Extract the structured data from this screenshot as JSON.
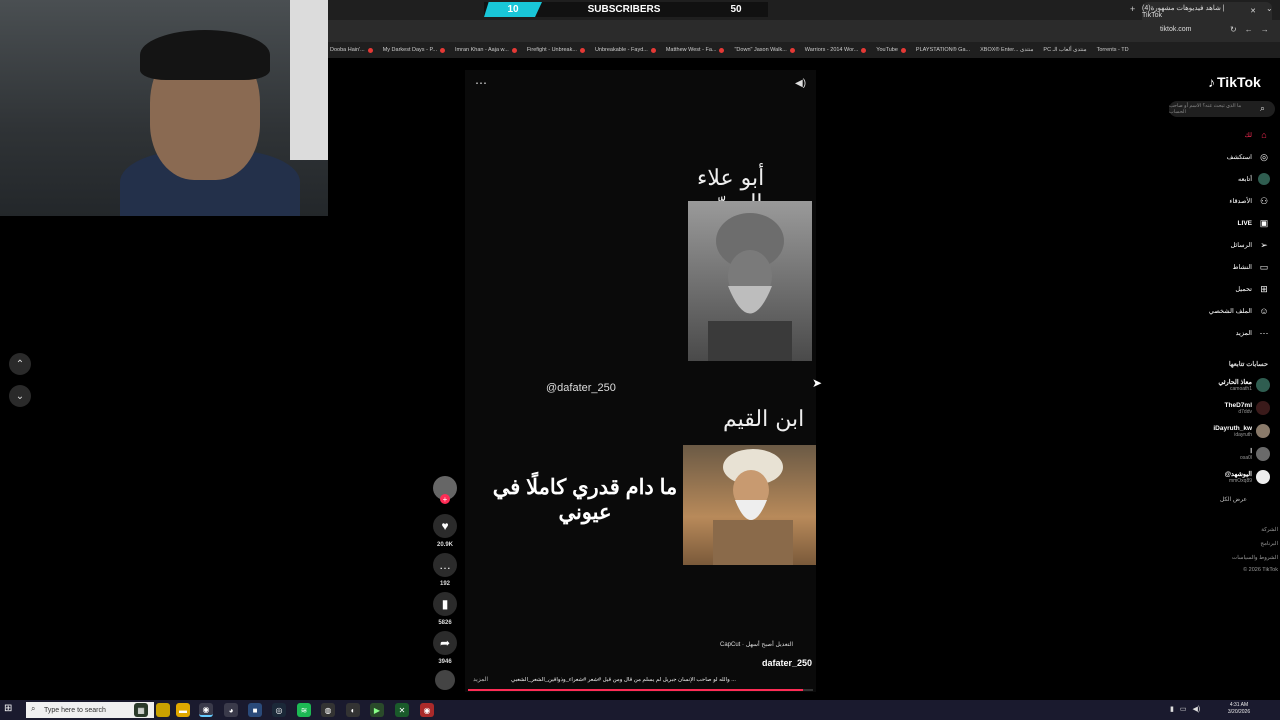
{
  "overlay": {
    "subscribers_current": "10",
    "subscribers_label": "SUBSCRIBERS",
    "subscribers_goal": "50"
  },
  "browser": {
    "active_tab_title": "(4)شاهد فيديوهات مشهورة | TikTok",
    "url": "tiktok.com",
    "bookmarks": [
      "Dooba Hain'...",
      "My Darkest Days - P...",
      "Imran Khan - Aaja w...",
      "Firefight - Unbreak...",
      "Unbreakable - Fayd...",
      "Matthew West - Fa...",
      "\"Down\" Jason Walk...",
      "Warriors - 2014 Wor...",
      "YouTube",
      "PLAYSTATION® Ga...",
      "XBOX® Enter... منتدى",
      "PC منتدى ألعاب الـ",
      "Torrents - TD"
    ]
  },
  "video": {
    "name_top": "أبو علاء المعرّي",
    "handle_watermark": "@dafater_250",
    "name_bottom": "ابن القيم",
    "quote": "ما دام قدري كاملًا في عيوني",
    "capcut_label": "CapCut · التعديل أصبح أسهل",
    "author": "dafater_250",
    "caption": "والله لو صاحب الإنسان جبريل لم يسلم من قال ومن قيل #شعر #شعراء_وذواقين_الشعر_الشعبي ...",
    "more_label": "المزيد",
    "progress": 0.97,
    "likes": "20.9K",
    "comments": "192",
    "saves": "5826",
    "shares": "3946"
  },
  "sidebar": {
    "logo": "TikTok",
    "search_placeholder": "ما الذي تبحث عنه؟ الاسم أو صاحب الحساب",
    "nav": [
      {
        "label": "لك",
        "icon": "home-icon"
      },
      {
        "label": "استكشف",
        "icon": "compass-icon"
      },
      {
        "label": "أتابعه",
        "icon": "following-icon"
      },
      {
        "label": "الأصدقاء",
        "icon": "friends-icon"
      },
      {
        "label": "LIVE",
        "icon": "live-icon"
      },
      {
        "label": "الرسائل",
        "icon": "messages-icon"
      },
      {
        "label": "النشاط",
        "icon": "activity-icon"
      },
      {
        "label": "تحميل",
        "icon": "upload-icon"
      },
      {
        "label": "الملف الشخصي",
        "icon": "profile-icon"
      },
      {
        "label": "المزيد",
        "icon": "more-icon"
      }
    ],
    "following_header": "حسابات تتابعها",
    "following": [
      {
        "name": "معاذ الحارثي",
        "user": "camoath1"
      },
      {
        "name": "TheD7ml",
        "user": "d7ddv"
      },
      {
        "name": "iDayruth_kw",
        "user": "idayruth"
      },
      {
        "name": "ا",
        "user": "osa0l"
      },
      {
        "name": "@اليوشهد",
        "user": "mmOxq89"
      }
    ],
    "see_all": "عرض الكل",
    "footer": [
      "الشركة",
      "البرنامج",
      "الشروط والسياسات",
      "© 2026 TikTok"
    ]
  },
  "taskbar": {
    "search_placeholder": "Type here to search",
    "time": "4:31 AM",
    "date": "3/20/2026"
  }
}
